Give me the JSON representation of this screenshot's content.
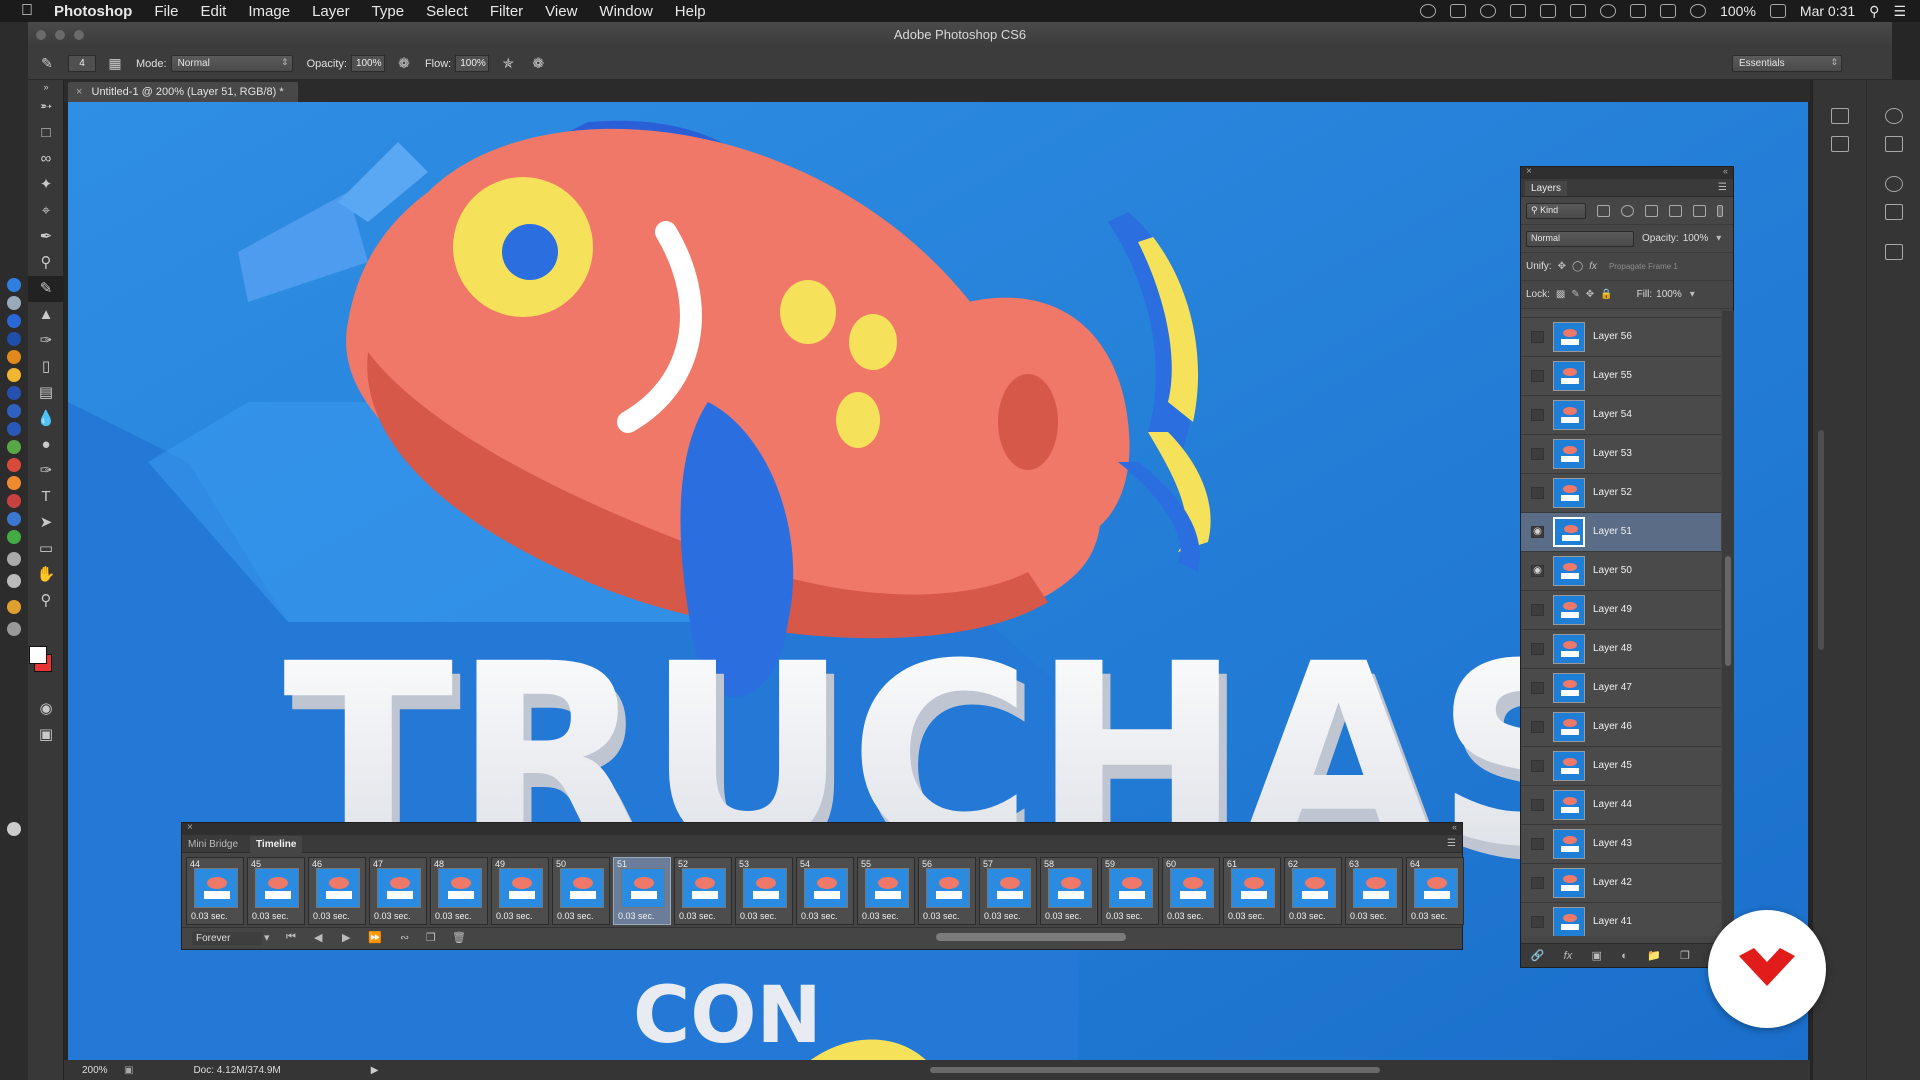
{
  "menubar": {
    "app": "Photoshop",
    "items": [
      "File",
      "Edit",
      "Image",
      "Layer",
      "Type",
      "Select",
      "Filter",
      "View",
      "Window",
      "Help"
    ],
    "battery": "100%",
    "clock": "Mar 0:31"
  },
  "window": {
    "title": "Adobe Photoshop CS6"
  },
  "options": {
    "brush_size": "4",
    "mode_label": "Mode:",
    "mode_value": "Normal",
    "opacity_label": "Opacity:",
    "opacity_value": "100%",
    "flow_label": "Flow:",
    "flow_value": "100%",
    "workspace": "Essentials"
  },
  "document": {
    "tab_title": "Untitled-1 @ 200% (Layer 51, RGB/8) *",
    "zoom": "200%",
    "doc_size": "Doc: 4.12M/374.9M"
  },
  "artwork": {
    "headline": "TRUCHAS",
    "subline": "CON"
  },
  "layers_panel": {
    "title": "Layers",
    "filter_kind": "Kind",
    "blend_mode": "Normal",
    "opacity_label": "Opacity:",
    "opacity_value": "100%",
    "unify_label": "Unify:",
    "propagate_label": "Propagate Frame 1",
    "lock_label": "Lock:",
    "fill_label": "Fill:",
    "fill_value": "100%",
    "layers": [
      {
        "name": "Layer 56",
        "visible": false,
        "selected": false
      },
      {
        "name": "Layer 55",
        "visible": false,
        "selected": false
      },
      {
        "name": "Layer 54",
        "visible": false,
        "selected": false
      },
      {
        "name": "Layer 53",
        "visible": false,
        "selected": false
      },
      {
        "name": "Layer 52",
        "visible": false,
        "selected": false
      },
      {
        "name": "Layer 51",
        "visible": true,
        "selected": true
      },
      {
        "name": "Layer 50",
        "visible": true,
        "selected": false
      },
      {
        "name": "Layer 49",
        "visible": false,
        "selected": false
      },
      {
        "name": "Layer 48",
        "visible": false,
        "selected": false
      },
      {
        "name": "Layer 47",
        "visible": false,
        "selected": false
      },
      {
        "name": "Layer 46",
        "visible": false,
        "selected": false
      },
      {
        "name": "Layer 45",
        "visible": false,
        "selected": false
      },
      {
        "name": "Layer 44",
        "visible": false,
        "selected": false
      },
      {
        "name": "Layer 43",
        "visible": false,
        "selected": false
      },
      {
        "name": "Layer 42",
        "visible": false,
        "selected": false
      },
      {
        "name": "Layer 41",
        "visible": false,
        "selected": false
      }
    ]
  },
  "timeline_panel": {
    "tab_mini_bridge": "Mini Bridge",
    "tab_timeline": "Timeline",
    "loop_value": "Forever",
    "selected_frame": "51",
    "frames": [
      {
        "num": "44",
        "delay": "0.03 sec."
      },
      {
        "num": "45",
        "delay": "0.03 sec."
      },
      {
        "num": "46",
        "delay": "0.03 sec."
      },
      {
        "num": "47",
        "delay": "0.03 sec."
      },
      {
        "num": "48",
        "delay": "0.03 sec."
      },
      {
        "num": "49",
        "delay": "0.03 sec."
      },
      {
        "num": "50",
        "delay": "0.03 sec."
      },
      {
        "num": "51",
        "delay": "0.03 sec."
      },
      {
        "num": "52",
        "delay": "0.03 sec."
      },
      {
        "num": "53",
        "delay": "0.03 sec."
      },
      {
        "num": "54",
        "delay": "0.03 sec."
      },
      {
        "num": "55",
        "delay": "0.03 sec."
      },
      {
        "num": "56",
        "delay": "0.03 sec."
      },
      {
        "num": "57",
        "delay": "0.03 sec."
      },
      {
        "num": "58",
        "delay": "0.03 sec."
      },
      {
        "num": "59",
        "delay": "0.03 sec."
      },
      {
        "num": "60",
        "delay": "0.03 sec."
      },
      {
        "num": "61",
        "delay": "0.03 sec."
      },
      {
        "num": "62",
        "delay": "0.03 sec."
      },
      {
        "num": "63",
        "delay": "0.03 sec."
      },
      {
        "num": "64",
        "delay": "0.03 sec."
      }
    ]
  },
  "icons": {
    "apple": "apple-logo-icon",
    "brush": "brush-icon",
    "eye": "eye-icon",
    "logo": "heart-logo-icon"
  },
  "colors": {
    "canvas_blue": "#1f7fd6",
    "fish_coral": "#f07868",
    "fish_yellow": "#f6e15a",
    "fish_blue": "#2a6ee0",
    "selection": "#5a6c86",
    "logo_red": "#e21b1b"
  }
}
